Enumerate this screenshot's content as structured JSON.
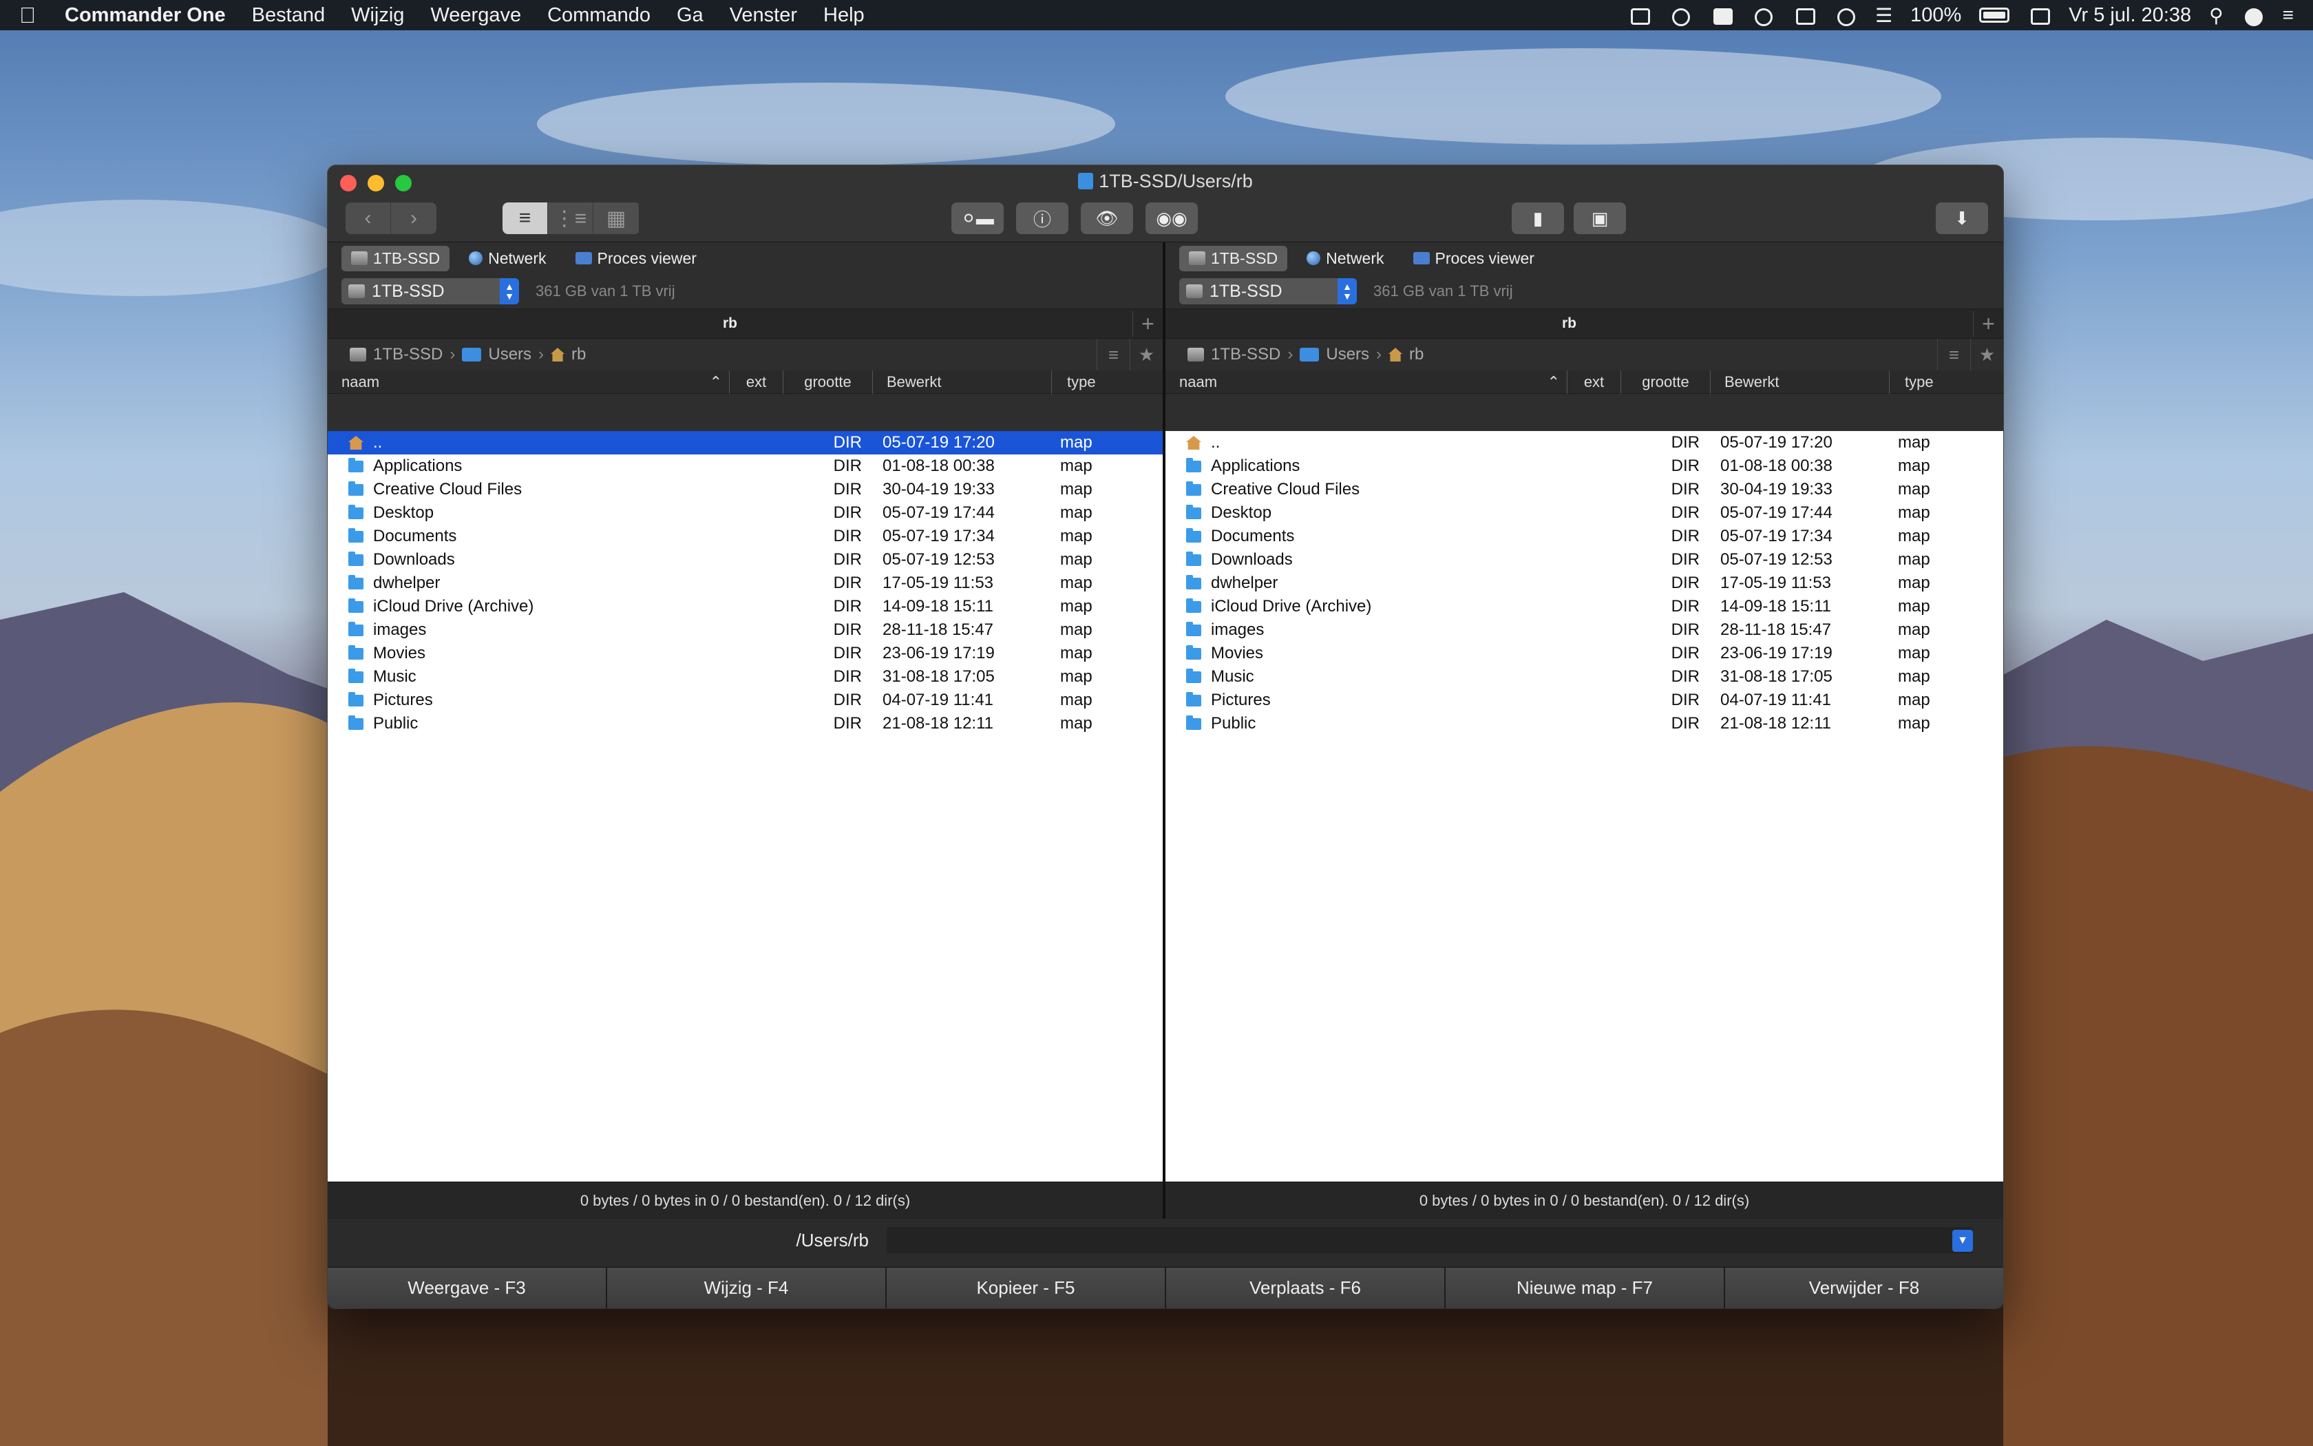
{
  "menubar": {
    "app_name": "Commander One",
    "items": [
      "Bestand",
      "Wijzig",
      "Weergave",
      "Commando",
      "Ga",
      "Venster",
      "Help"
    ],
    "battery": "100%",
    "clock": "Vr 5 jul.  20:38"
  },
  "window": {
    "title": "1TB-SSD/Users/rb"
  },
  "left": {
    "tabs": [
      "1TB-SSD",
      "Netwerk",
      "Proces viewer"
    ],
    "drive": "1TB-SSD",
    "free_space": "361 GB van 1 TB vrij",
    "tab_name": "rb",
    "breadcrumb": [
      "1TB-SSD",
      "Users",
      "rb"
    ],
    "columns": [
      "naam",
      "ext",
      "grootte",
      "Bewerkt",
      "type"
    ],
    "rows": [
      {
        "name": "..",
        "size": "DIR",
        "date": "05-07-19 17:20",
        "type": "map"
      },
      {
        "name": "Applications",
        "size": "DIR",
        "date": "01-08-18 00:38",
        "type": "map"
      },
      {
        "name": "Creative Cloud Files",
        "size": "DIR",
        "date": "30-04-19 19:33",
        "type": "map"
      },
      {
        "name": "Desktop",
        "size": "DIR",
        "date": "05-07-19 17:44",
        "type": "map"
      },
      {
        "name": "Documents",
        "size": "DIR",
        "date": "05-07-19 17:34",
        "type": "map"
      },
      {
        "name": "Downloads",
        "size": "DIR",
        "date": "05-07-19 12:53",
        "type": "map"
      },
      {
        "name": "dwhelper",
        "size": "DIR",
        "date": "17-05-19 11:53",
        "type": "map"
      },
      {
        "name": "iCloud Drive (Archive)",
        "size": "DIR",
        "date": "14-09-18 15:11",
        "type": "map"
      },
      {
        "name": "images",
        "size": "DIR",
        "date": "28-11-18 15:47",
        "type": "map"
      },
      {
        "name": "Movies",
        "size": "DIR",
        "date": "23-06-19 17:19",
        "type": "map"
      },
      {
        "name": "Music",
        "size": "DIR",
        "date": "31-08-18 17:05",
        "type": "map"
      },
      {
        "name": "Pictures",
        "size": "DIR",
        "date": "04-07-19 11:41",
        "type": "map"
      },
      {
        "name": "Public",
        "size": "DIR",
        "date": "21-08-18 12:11",
        "type": "map"
      }
    ],
    "status": "0 bytes / 0 bytes in 0 / 0 bestand(en). 0 / 12 dir(s)"
  },
  "right": {
    "tabs": [
      "1TB-SSD",
      "Netwerk",
      "Proces viewer"
    ],
    "drive": "1TB-SSD",
    "free_space": "361 GB van 1 TB vrij",
    "tab_name": "rb",
    "breadcrumb": [
      "1TB-SSD",
      "Users",
      "rb"
    ],
    "columns": [
      "naam",
      "ext",
      "grootte",
      "Bewerkt",
      "type"
    ],
    "rows": [
      {
        "name": "..",
        "size": "DIR",
        "date": "05-07-19 17:20",
        "type": "map"
      },
      {
        "name": "Applications",
        "size": "DIR",
        "date": "01-08-18 00:38",
        "type": "map"
      },
      {
        "name": "Creative Cloud Files",
        "size": "DIR",
        "date": "30-04-19 19:33",
        "type": "map"
      },
      {
        "name": "Desktop",
        "size": "DIR",
        "date": "05-07-19 17:44",
        "type": "map"
      },
      {
        "name": "Documents",
        "size": "DIR",
        "date": "05-07-19 17:34",
        "type": "map"
      },
      {
        "name": "Downloads",
        "size": "DIR",
        "date": "05-07-19 12:53",
        "type": "map"
      },
      {
        "name": "dwhelper",
        "size": "DIR",
        "date": "17-05-19 11:53",
        "type": "map"
      },
      {
        "name": "iCloud Drive (Archive)",
        "size": "DIR",
        "date": "14-09-18 15:11",
        "type": "map"
      },
      {
        "name": "images",
        "size": "DIR",
        "date": "28-11-18 15:47",
        "type": "map"
      },
      {
        "name": "Movies",
        "size": "DIR",
        "date": "23-06-19 17:19",
        "type": "map"
      },
      {
        "name": "Music",
        "size": "DIR",
        "date": "31-08-18 17:05",
        "type": "map"
      },
      {
        "name": "Pictures",
        "size": "DIR",
        "date": "04-07-19 11:41",
        "type": "map"
      },
      {
        "name": "Public",
        "size": "DIR",
        "date": "21-08-18 12:11",
        "type": "map"
      }
    ],
    "status": "0 bytes / 0 bytes in 0 / 0 bestand(en). 0 / 12 dir(s)"
  },
  "command_line": {
    "path": "/Users/rb",
    "value": ""
  },
  "function_keys": [
    "Weergave - F3",
    "Wijzig - F4",
    "Kopieer - F5",
    "Verplaats - F6",
    "Nieuwe map - F7",
    "Verwijder - F8"
  ],
  "colors": {
    "selection": "#1a55d8",
    "folder": "#3b9be8",
    "accent": "#2a6fe0"
  }
}
